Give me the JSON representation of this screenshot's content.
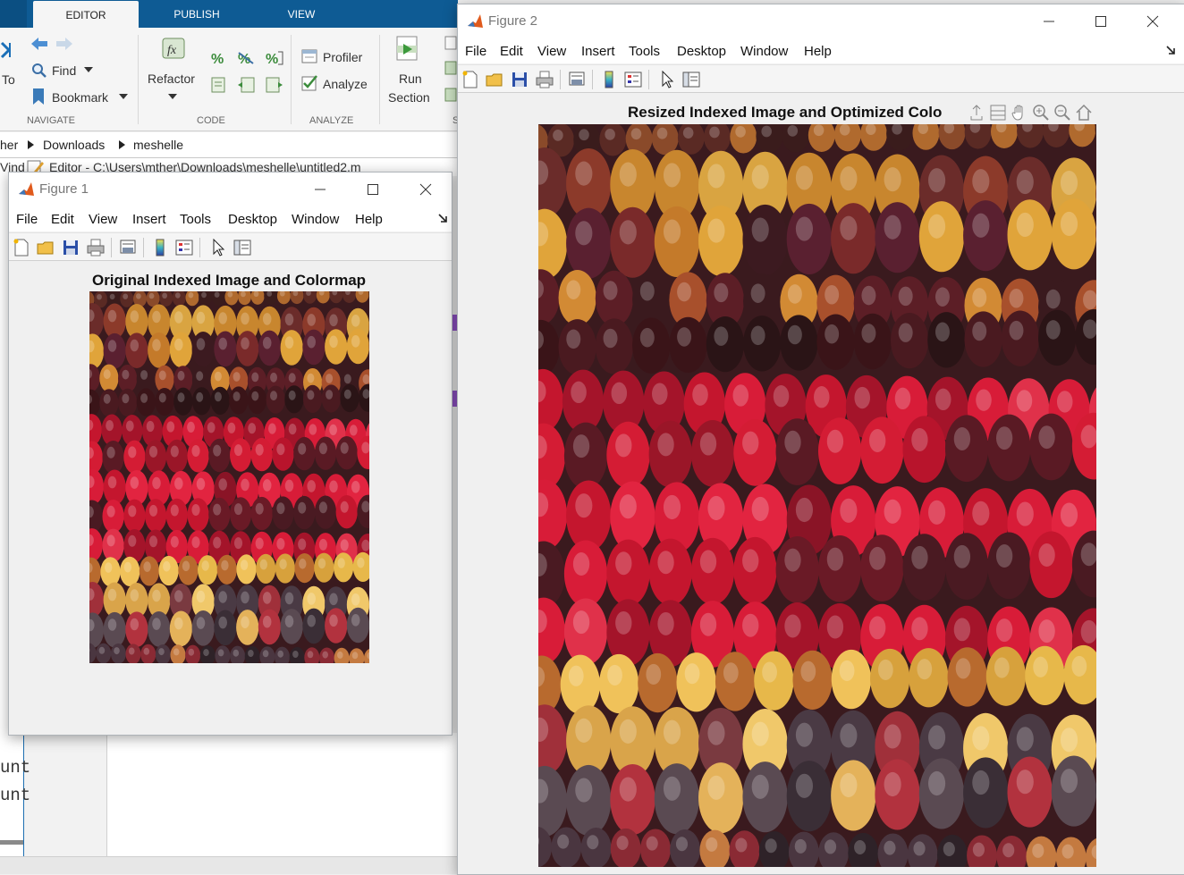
{
  "ribbon": {
    "tabs": [
      "EDITOR",
      "PUBLISH",
      "VIEW"
    ],
    "navigate": {
      "go_to_label": "To",
      "find_label": "Find",
      "bookmark_label": "Bookmark",
      "section": "NAVIGATE"
    },
    "code": {
      "refactor_label": "Refactor",
      "section": "CODE"
    },
    "analyze": {
      "profiler_label": "Profiler",
      "analyze_label": "Analyze",
      "section": "ANALYZE"
    },
    "run": {
      "run_label": "Run",
      "section_label": "Section",
      "section": "S"
    }
  },
  "breadcrumb": {
    "items": [
      "her",
      "Downloads",
      "meshelle"
    ]
  },
  "editor": {
    "title": "Editor - C:\\Users\\mther\\Downloads\\meshelle\\untitled2.m",
    "left_label": "Vind",
    "code_lines": [
      "unt",
      "unt"
    ]
  },
  "figure1": {
    "window_title": "Figure 1",
    "menu": [
      "File",
      "Edit",
      "View",
      "Insert",
      "Tools",
      "Desktop",
      "Window",
      "Help"
    ],
    "axes_title": "Original Indexed Image and Colormap"
  },
  "figure2": {
    "window_title": "Figure 2",
    "menu": [
      "File",
      "Edit",
      "View",
      "Insert",
      "Tools",
      "Desktop",
      "Window",
      "Help"
    ],
    "axes_title": "Resized Indexed Image and Optimized Colo"
  },
  "colors": {
    "ribbon_blue": "#0e5b94",
    "corn_red": "#c4162e",
    "corn_dark": "#4a1c24",
    "corn_gold": "#e0a43a"
  }
}
